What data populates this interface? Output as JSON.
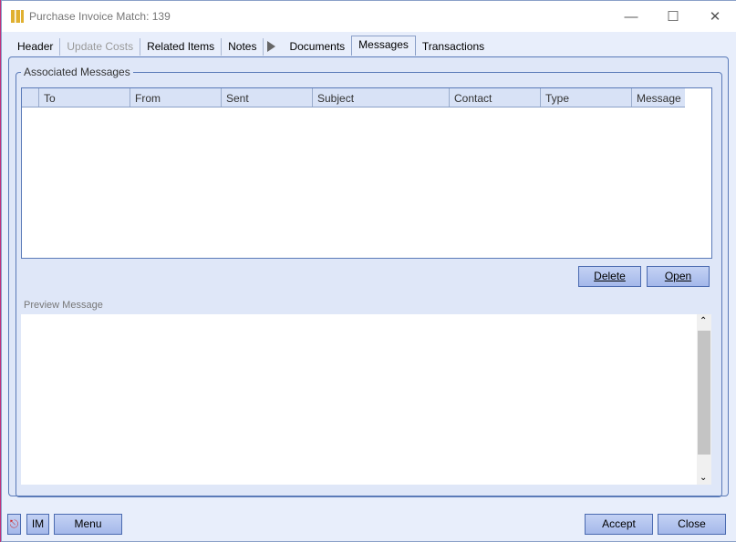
{
  "window": {
    "title": "Purchase Invoice Match: 139"
  },
  "tabs": [
    {
      "label": "Header"
    },
    {
      "label": "Update Costs"
    },
    {
      "label": "Related Items"
    },
    {
      "label": "Notes"
    },
    {
      "label": "Documents"
    },
    {
      "label": "Messages"
    },
    {
      "label": "Transactions"
    }
  ],
  "messages": {
    "group_label": "Associated Messages",
    "columns": [
      "To",
      "From",
      "Sent",
      "Subject",
      "Contact",
      "Type",
      "Message"
    ],
    "delete_label": "Delete",
    "open_label": "Open",
    "preview_label": "Preview Message"
  },
  "footer": {
    "im_label": "IM",
    "menu_label": "Menu",
    "accept_label": "Accept",
    "close_label": "Close"
  }
}
